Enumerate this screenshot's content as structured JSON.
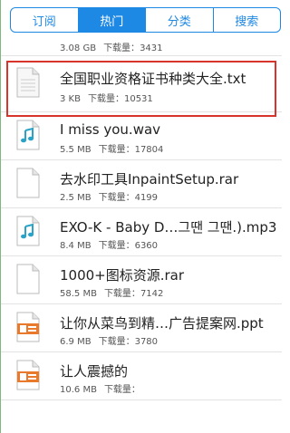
{
  "tabs": [
    {
      "label": "订阅",
      "active": false
    },
    {
      "label": "热门",
      "active": true
    },
    {
      "label": "分类",
      "active": false
    },
    {
      "label": "搜索",
      "active": false
    }
  ],
  "download_prefix": "下载量：",
  "files": [
    {
      "name": "",
      "size": "3.08 GB",
      "downloads": "3431",
      "icon": "doc-icon"
    },
    {
      "name": "全国职业资格证书种类大全.txt",
      "size": "3 KB",
      "downloads": "10531",
      "icon": "text-file-icon"
    },
    {
      "name": "I miss you.wav",
      "size": "5.5 MB",
      "downloads": "17804",
      "icon": "music-file-icon"
    },
    {
      "name": "去水印工具InpaintSetup.rar",
      "size": "2.5 MB",
      "downloads": "4199",
      "icon": "archive-file-icon"
    },
    {
      "name": "EXO-K - Baby D…그땐 그땐.).mp3",
      "size": "8.4 MB",
      "downloads": "6360",
      "icon": "music-file-icon"
    },
    {
      "name": "1000+图标资源.rar",
      "size": "58.5 MB",
      "downloads": "7142",
      "icon": "archive-file-icon"
    },
    {
      "name": "让你从菜鸟到精…广告提案网.ppt",
      "size": "6.9 MB",
      "downloads": "3780",
      "icon": "ppt-file-icon"
    },
    {
      "name": "让人震撼的",
      "size": "10.6 MB",
      "downloads": "",
      "icon": "ppt-file-icon"
    }
  ],
  "colors": {
    "accent": "#1e88e5",
    "selection": "#d9342b"
  }
}
